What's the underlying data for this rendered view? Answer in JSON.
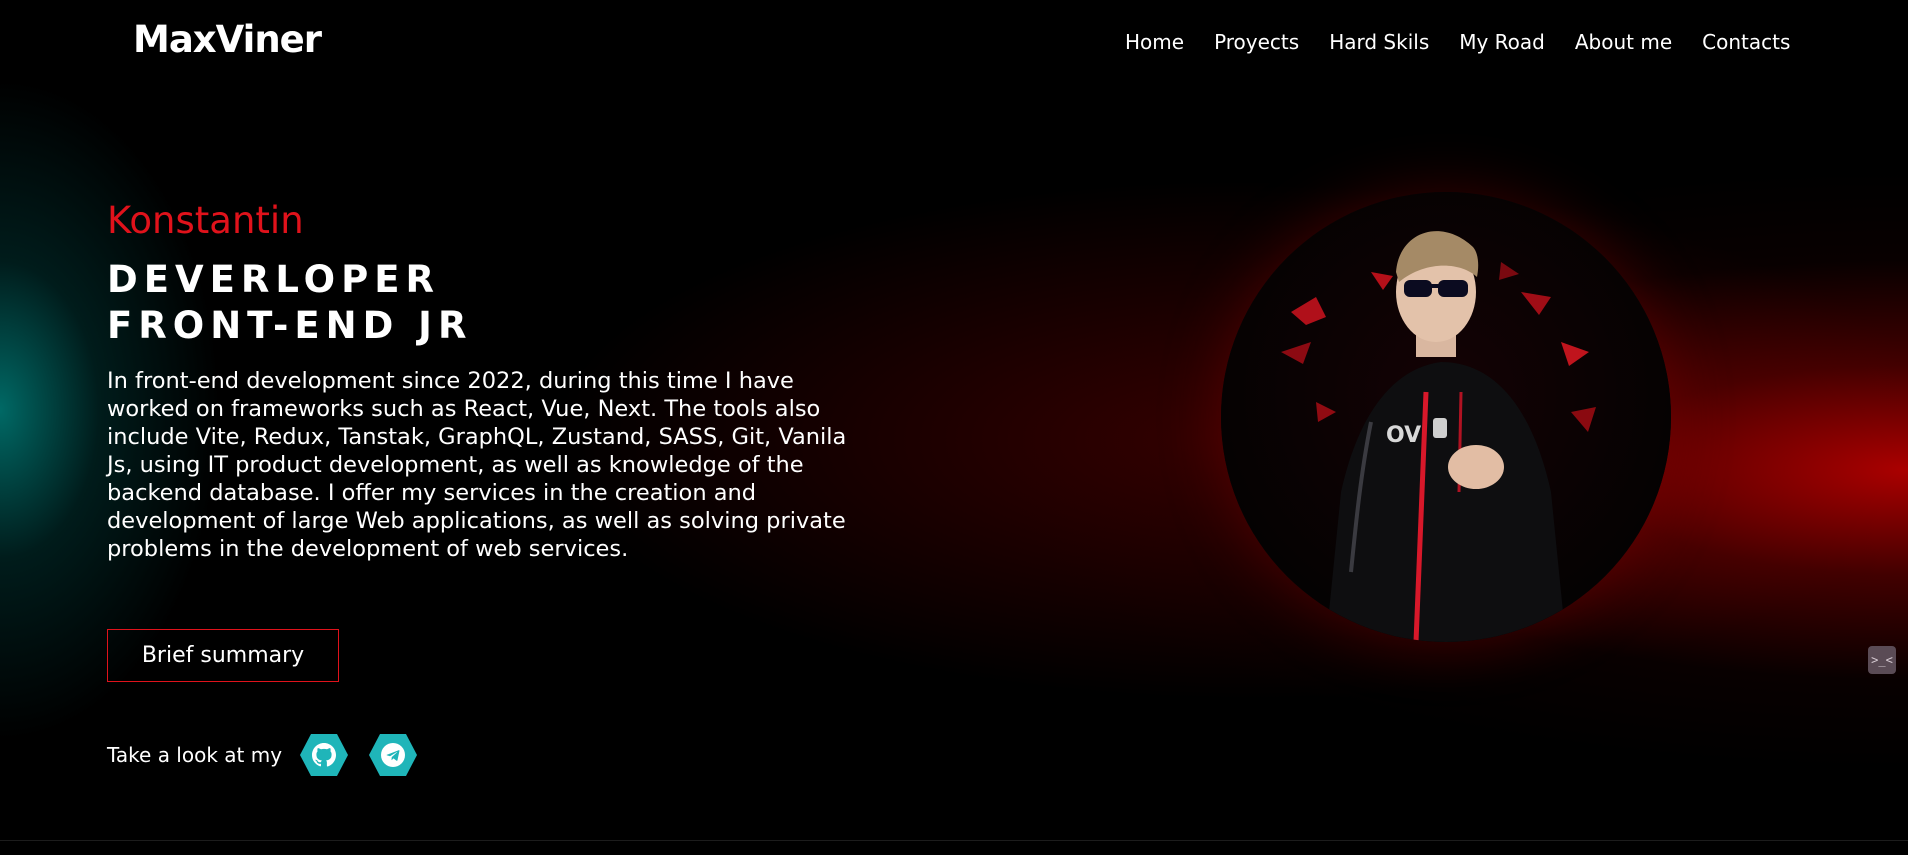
{
  "header": {
    "logo": "MaxViner",
    "nav": [
      "Home",
      "Proyects",
      "Hard Skils",
      "My Road",
      "About me",
      "Contacts"
    ]
  },
  "hero": {
    "name": "Konstantin",
    "role_line1": "DEVERLOPER",
    "role_line2": "FRONT-END JR",
    "description": "In front-end development since 2022, during this time I have worked on frameworks such as React, Vue, Next. The tools also include Vite, Redux, Tanstak, GraphQL, Zustand, SASS, Git, Vanila Js, using IT product development, as well as knowledge of the backend database. I offer my services in the creation and development of large Web applications, as well as solving private problems in the development of web services.",
    "button_label": "Brief summary",
    "social_label": "Take a look at my",
    "social_icons": [
      "github-icon",
      "telegram-icon"
    ]
  },
  "widget": {
    "label": ">_<"
  },
  "colors": {
    "accent": "#e0121b",
    "teal": "#1fb5b9",
    "background": "#000000"
  }
}
